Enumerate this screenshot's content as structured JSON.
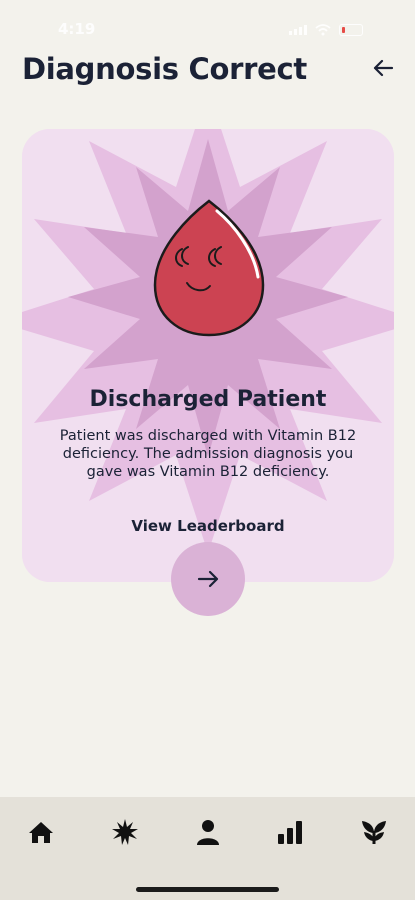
{
  "status_bar": {
    "time": "4:19"
  },
  "header": {
    "title": "Diagnosis Correct",
    "back_icon": "arrow-left-icon"
  },
  "card": {
    "illustration": "smiling-blood-drop",
    "title": "Discharged Patient",
    "message": "Patient was discharged with Vitamin B12 deficiency. The admission diagnosis you gave was Vitamin B12 deficiency.",
    "leaderboard_label": "View Leaderboard",
    "next_icon": "arrow-right-icon"
  },
  "colors": {
    "background": "#f3f2ec",
    "card": "#f1dff0",
    "burst_outer": "#e6bfe2",
    "burst_inner": "#d3a2cd",
    "drop": "#cc4352",
    "accent_button": "#dab2d6",
    "text": "#1b2236"
  },
  "tab_bar": {
    "items": [
      {
        "name": "home",
        "icon": "home-icon"
      },
      {
        "name": "explore",
        "icon": "starburst-icon"
      },
      {
        "name": "profile",
        "icon": "person-icon"
      },
      {
        "name": "stats",
        "icon": "bar-chart-icon"
      },
      {
        "name": "growth",
        "icon": "sprout-icon"
      }
    ]
  }
}
